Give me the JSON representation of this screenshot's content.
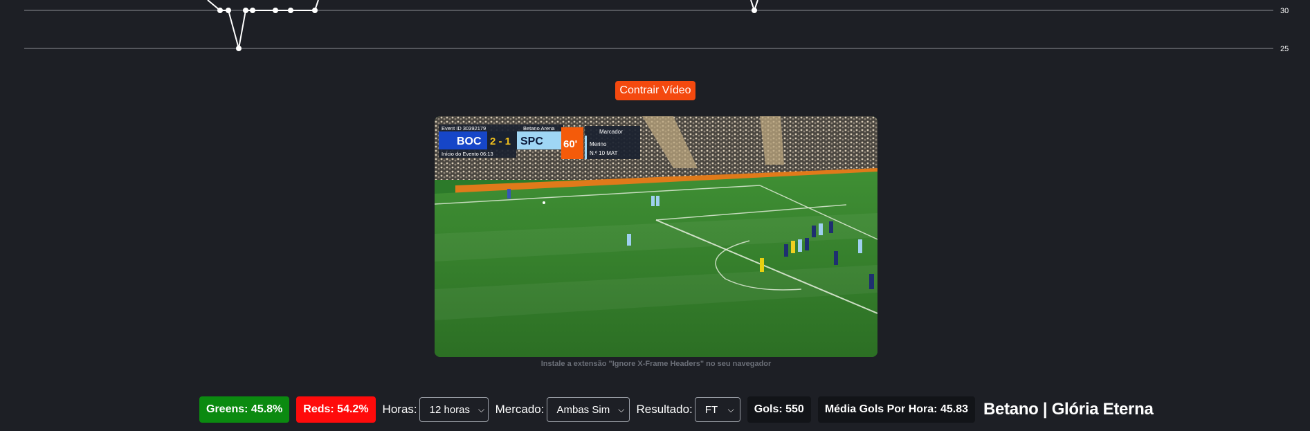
{
  "chart": {
    "tick_labels": [
      "30",
      "25"
    ],
    "line_color": "#ffffff",
    "grid_color": "#8a8d94"
  },
  "chart_data": {
    "type": "line",
    "title": "",
    "xlabel": "",
    "ylabel": "",
    "y_ticks": [
      30,
      25
    ],
    "grid": true,
    "note_visible_values": [
      30,
      30,
      25,
      30,
      30,
      30,
      30,
      30,
      30
    ]
  },
  "video": {
    "toggle_label": "Contrair Vídeo",
    "hint": "Instale a extensão \"Ignore X-Frame Headers\" no seu navegador",
    "scoreboard": {
      "event_id": "Event ID 30392179",
      "venue": "Betano Arena",
      "home_team": "BOC",
      "score": "2 - 1",
      "away_team": "SPC",
      "minute": "60'",
      "event_start": "Início do Evento 06:13",
      "scorer_header": "Marcador",
      "scorer_name": "Merino",
      "scorer_detail": "N.º 10 MAT"
    }
  },
  "toolbar": {
    "greens": "Greens: 45.8%",
    "reds": "Reds: 54.2%",
    "hours_label": "Horas:",
    "hours_value": "12 horas",
    "market_label": "Mercado:",
    "market_value": "Ambas Sim",
    "result_label": "Resultado:",
    "result_value": "FT",
    "goals": "Gols: 550",
    "avg_goals": "Média Gols Por Hora: 45.83",
    "title": "Betano | Glória Eterna"
  },
  "colors": {
    "background": "#1d1f25",
    "accent_orange": "#f4490f",
    "green": "#0b8a10",
    "red": "#ff0b0b",
    "dark_badge": "#121418"
  },
  "icons": {
    "select_chevron": "chevron-down-icon"
  }
}
